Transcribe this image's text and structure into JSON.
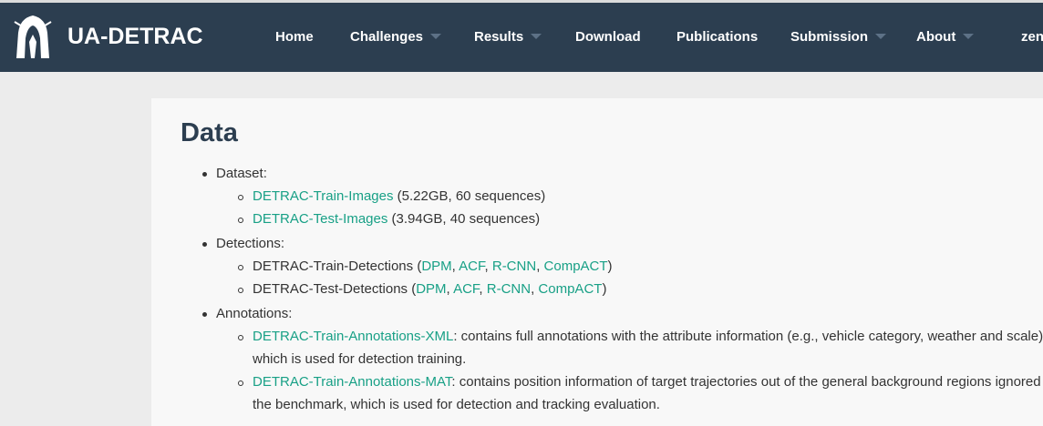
{
  "brand": "UA-DETRAC",
  "nav": {
    "home": "Home",
    "challenges": "Challenges",
    "results": "Results",
    "download": "Download",
    "publications": "Publications",
    "submission": "Submission",
    "about": "About",
    "user": "zen"
  },
  "page_title": "Data",
  "sections": {
    "dataset": {
      "label": "Dataset:",
      "train_link": "DETRAC-Train-Images",
      "train_info": "(5.22GB, 60 sequences)",
      "test_link": "DETRAC-Test-Images",
      "test_info": "(3.94GB, 40 sequences)"
    },
    "detections": {
      "label": "Detections:",
      "train_name": "DETRAC-Train-Detections (",
      "test_name": "DETRAC-Test-Detections (",
      "dpm": "DPM",
      "acf": "ACF",
      "rcnn": "R-CNN",
      "compact": "CompACT",
      "sep": ", ",
      "close": ")"
    },
    "annotations": {
      "label": "Annotations:",
      "xml_link": "DETRAC-Train-Annotations-XML",
      "xml_text_1": ": contains full annotations with the attribute information (e.g., vehicle category, weather and scale),",
      "xml_text_2": "which is used for detection training.",
      "mat_link": "DETRAC-Train-Annotations-MAT",
      "mat_text_1": ": contains position information of target trajectories out of the general background regions ignored in",
      "mat_text_2": "the benchmark, which is used for detection and tracking evaluation."
    }
  }
}
